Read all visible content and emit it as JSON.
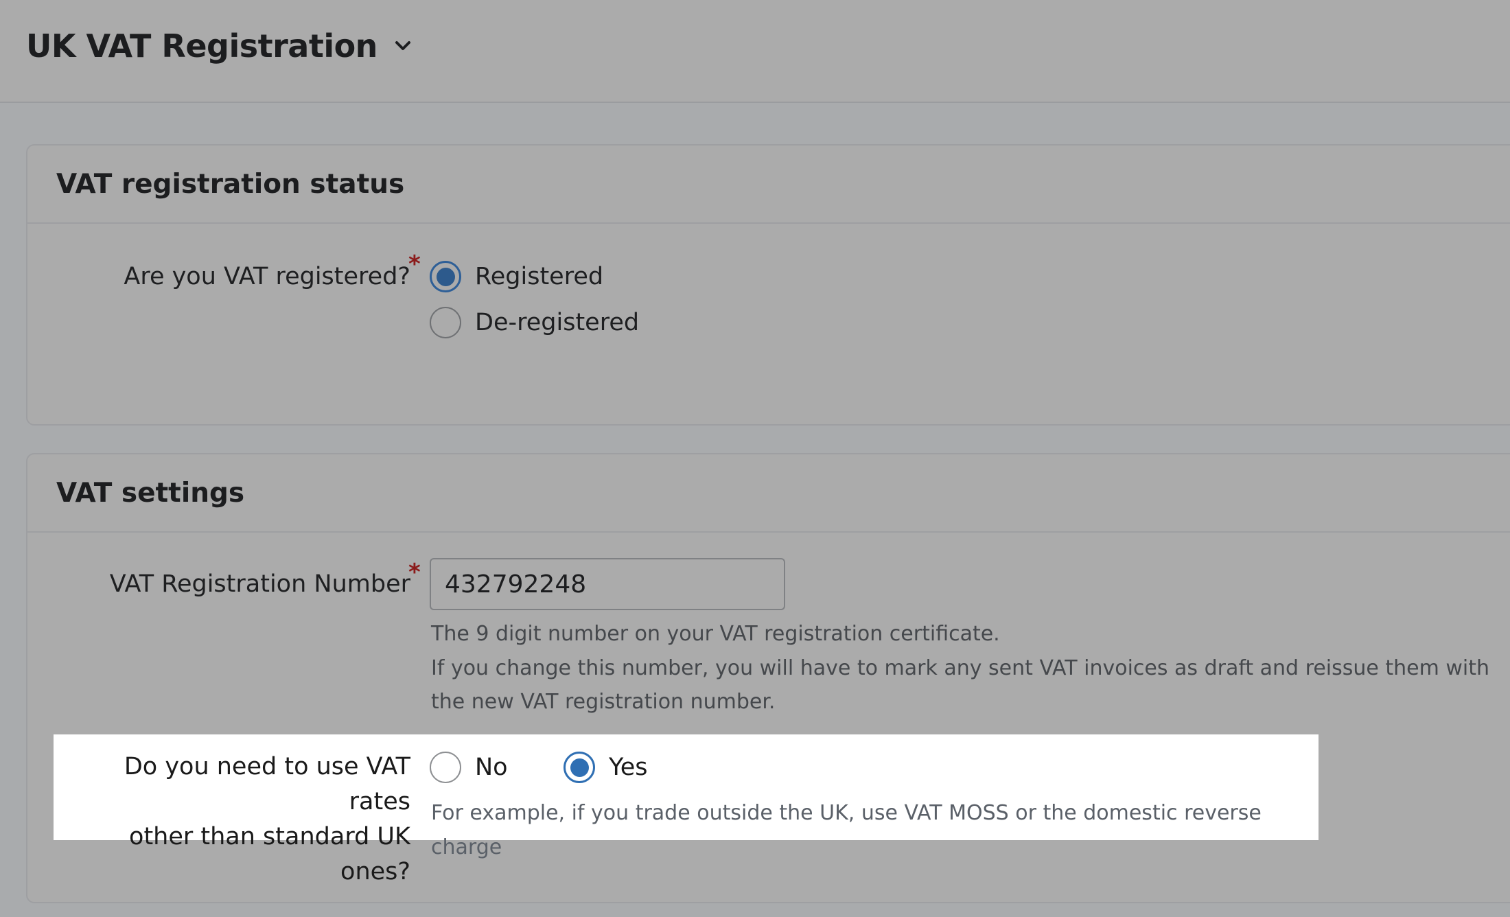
{
  "header": {
    "title": "UK VAT Registration",
    "chevron_icon": "chevron-down-icon"
  },
  "registration_status": {
    "title": "VAT registration status",
    "question": "Are you VAT registered?",
    "required_mark": "*",
    "options": [
      {
        "label": "Registered",
        "selected": true
      },
      {
        "label": "De-registered",
        "selected": false
      }
    ]
  },
  "vat_settings": {
    "title": "VAT settings",
    "number_label": "VAT Registration Number",
    "required_mark": "*",
    "number_value": "432792248",
    "hint_line_1": "The 9 digit number on your VAT registration certificate.",
    "hint_line_2": "If you change this number, you will have to mark any sent VAT invoices as draft and reissue them with",
    "hint_line_3": "the new VAT registration number.",
    "other_rates": {
      "question_line_1": "Do you need to use VAT rates",
      "question_line_2": "other than standard UK ones?",
      "options": [
        {
          "label": "No",
          "selected": false
        },
        {
          "label": "Yes",
          "selected": true
        }
      ],
      "hint": "For example, if you trade outside the UK, use VAT MOSS or the domestic reverse charge"
    }
  },
  "colors": {
    "accent": "#2f6fb3",
    "required": "#8b1a1a",
    "highlight_bg": "#ffffff"
  }
}
